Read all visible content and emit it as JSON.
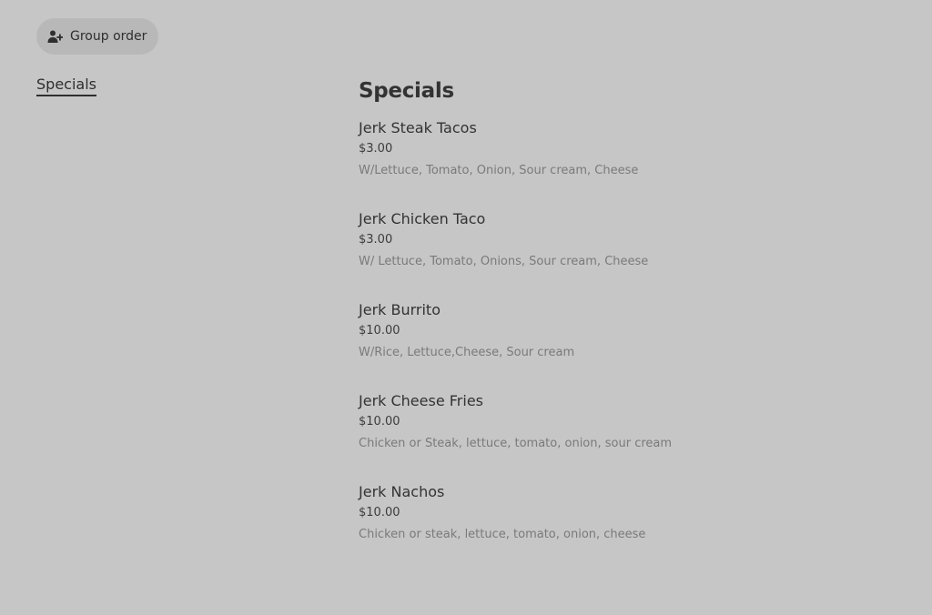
{
  "header": {
    "group_order_label": "Group order",
    "group_order_icon": "add-person-icon"
  },
  "sidebar": {
    "items": [
      {
        "label": "Specials",
        "active": true
      }
    ]
  },
  "menu": {
    "section_title": "Specials",
    "items": [
      {
        "name": "Jerk Steak Tacos",
        "price": "$3.00",
        "description": "W/Lettuce, Tomato, Onion, Sour cream, Cheese"
      },
      {
        "name": "Jerk Chicken Taco",
        "price": "$3.00",
        "description": "W/ Lettuce, Tomato, Onions, Sour cream, Cheese"
      },
      {
        "name": "Jerk Burrito",
        "price": "$10.00",
        "description": "W/Rice, Lettuce,Cheese, Sour cream"
      },
      {
        "name": "Jerk Cheese Fries",
        "price": "$10.00",
        "description": "Chicken or Steak, lettuce, tomato, onion, sour cream"
      },
      {
        "name": "Jerk Nachos",
        "price": "$10.00",
        "description": "Chicken or steak, lettuce, tomato, onion, cheese"
      }
    ]
  },
  "colors": {
    "background": "#c6c6c6",
    "button_background": "#b8b8b8",
    "text_primary": "#333333",
    "text_secondary": "#7a7a7a"
  }
}
